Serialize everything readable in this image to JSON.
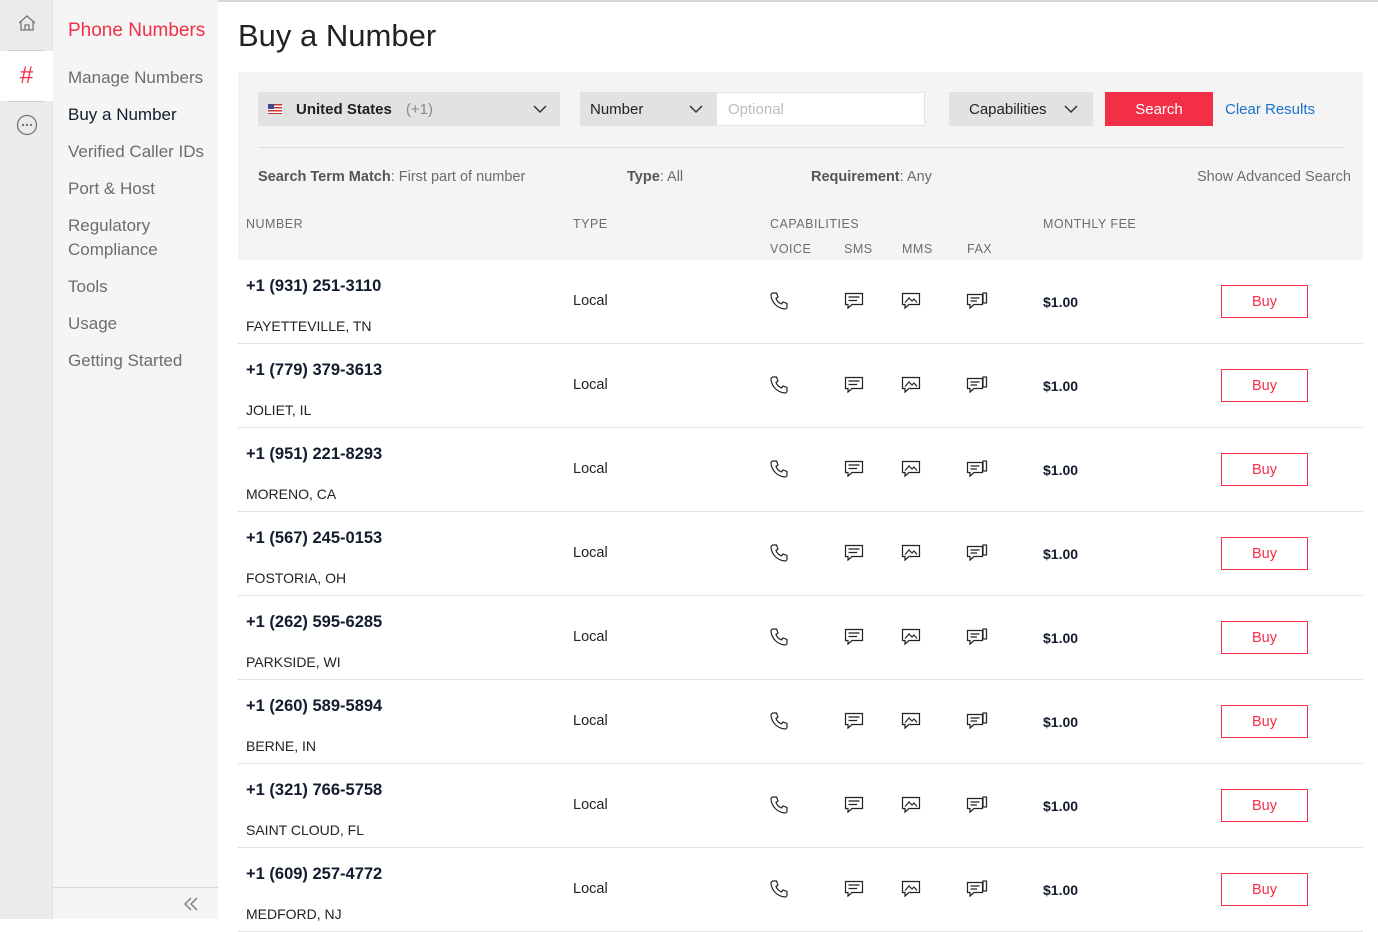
{
  "nav": {
    "section_title": "Phone Numbers",
    "items": [
      {
        "label": "Manage Numbers",
        "active": false
      },
      {
        "label": "Buy a Number",
        "active": true
      },
      {
        "label": "Verified Caller IDs",
        "active": false
      },
      {
        "label": "Port & Host",
        "active": false
      },
      {
        "label": "Regulatory Compliance",
        "active": false
      },
      {
        "label": "Tools",
        "active": false
      },
      {
        "label": "Usage",
        "active": false
      },
      {
        "label": "Getting Started",
        "active": false
      }
    ]
  },
  "page": {
    "title": "Buy a Number"
  },
  "search": {
    "country_name": "United States",
    "country_code": "(+1)",
    "match_type": "Number",
    "number_placeholder": "Optional",
    "number_value": "",
    "capabilities_label": "Capabilities",
    "search_label": "Search",
    "clear_label": "Clear Results",
    "show_advanced_label": "Show Advanced Search",
    "filters": {
      "term_match_label": "Search Term Match",
      "term_match_value": ": First part of number",
      "type_label": "Type",
      "type_value": ": All",
      "requirement_label": "Requirement",
      "requirement_value": ": Any"
    }
  },
  "table": {
    "headers": {
      "number": "NUMBER",
      "type": "TYPE",
      "capabilities": "CAPABILITIES",
      "voice": "VOICE",
      "sms": "SMS",
      "mms": "MMS",
      "fax": "FAX",
      "monthly_fee": "MONTHLY FEE"
    },
    "buy_label": "Buy",
    "rows": [
      {
        "number": "+1 (931) 251-3110",
        "location": "FAYETTEVILLE, TN",
        "type": "Local",
        "fee": "$1.00"
      },
      {
        "number": "+1 (779) 379-3613",
        "location": "JOLIET, IL",
        "type": "Local",
        "fee": "$1.00"
      },
      {
        "number": "+1 (951) 221-8293",
        "location": "MORENO, CA",
        "type": "Local",
        "fee": "$1.00"
      },
      {
        "number": "+1 (567) 245-0153",
        "location": "FOSTORIA, OH",
        "type": "Local",
        "fee": "$1.00"
      },
      {
        "number": "+1 (262) 595-6285",
        "location": "PARKSIDE, WI",
        "type": "Local",
        "fee": "$1.00"
      },
      {
        "number": "+1 (260) 589-5894",
        "location": "BERNE, IN",
        "type": "Local",
        "fee": "$1.00"
      },
      {
        "number": "+1 (321) 766-5758",
        "location": "SAINT CLOUD, FL",
        "type": "Local",
        "fee": "$1.00"
      },
      {
        "number": "+1 (609) 257-4772",
        "location": "MEDFORD, NJ",
        "type": "Local",
        "fee": "$1.00"
      }
    ]
  },
  "icons": {
    "rail": [
      "home-icon",
      "hash-icon",
      "more-icon"
    ],
    "capabilities": [
      "phone-icon",
      "sms-icon",
      "mms-icon",
      "fax-icon"
    ],
    "collapse": "double-chevron-left-icon"
  },
  "colors": {
    "accent": "#f22f46",
    "link": "#1a73c9"
  }
}
